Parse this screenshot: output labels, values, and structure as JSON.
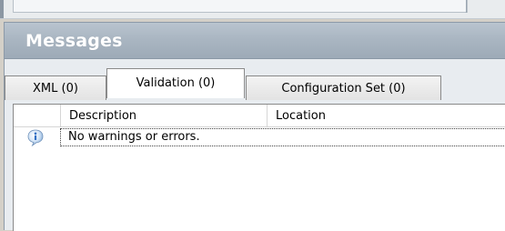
{
  "panel": {
    "title": "Messages"
  },
  "tabs": [
    {
      "label": "XML (0)",
      "selected": false
    },
    {
      "label": "Validation (0)",
      "selected": true
    },
    {
      "label": "Configuration Set (0)",
      "selected": false
    }
  ],
  "table": {
    "columns": [
      "",
      "Description",
      "Location"
    ],
    "rows": [
      {
        "icon": "info-icon",
        "description": "No warnings or errors.",
        "location": ""
      }
    ]
  },
  "colors": {
    "header_gradient_top": "#b9c4cf",
    "header_gradient_bottom": "#9daab7",
    "title_text": "#ffffff",
    "info_icon_blue": "#2f6fc3"
  }
}
